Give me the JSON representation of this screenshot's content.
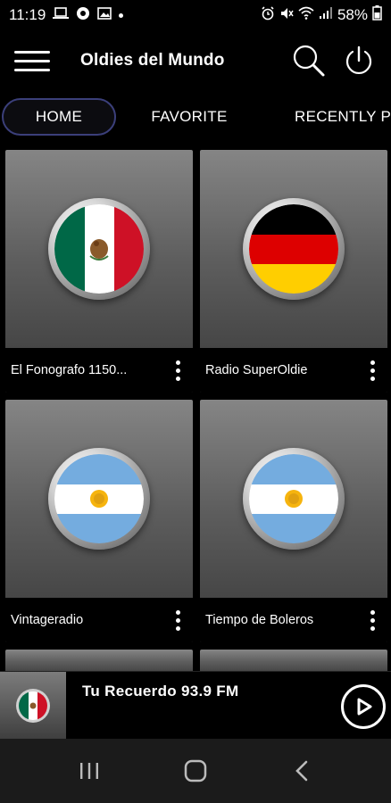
{
  "status_bar": {
    "time": "11:19",
    "battery": "58%",
    "left_icons": [
      "laptop-icon",
      "app-notification-icon",
      "image-icon",
      "dot-icon"
    ],
    "right_icons": [
      "alarm-icon",
      "mute-icon",
      "wifi-icon",
      "signal-icon",
      "battery-icon"
    ]
  },
  "app_bar": {
    "title": "Oldies del Mundo",
    "icons": [
      "menu-icon",
      "search-icon",
      "power-icon"
    ]
  },
  "tabs": [
    {
      "label": "HOME",
      "active": true
    },
    {
      "label": "FAVORITE",
      "active": false
    },
    {
      "label": "RECENTLY P",
      "active": false
    }
  ],
  "stations": [
    {
      "name": "El Fonografo 1150...",
      "flag": "mexico-flag-icon"
    },
    {
      "name": "Radio SuperOldie",
      "flag": "germany-flag-icon"
    },
    {
      "name": "Vintageradio",
      "flag": "argentina-flag-icon"
    },
    {
      "name": "Tiempo de Boleros",
      "flag": "argentina-flag-icon"
    }
  ],
  "player": {
    "title": "Tu Recuerdo  93.9 FM",
    "flag": "mexico-flag-icon",
    "action_icon": "play-icon"
  },
  "nav_bar": {
    "icons": [
      "recents-icon",
      "home-icon",
      "back-icon"
    ]
  },
  "colors": {
    "background": "#000000",
    "card_top": "#858585",
    "card_bottom": "#3a3a3a",
    "active_tab_border": "#3b3f7a",
    "nav_bar": "#1b1b1b"
  }
}
